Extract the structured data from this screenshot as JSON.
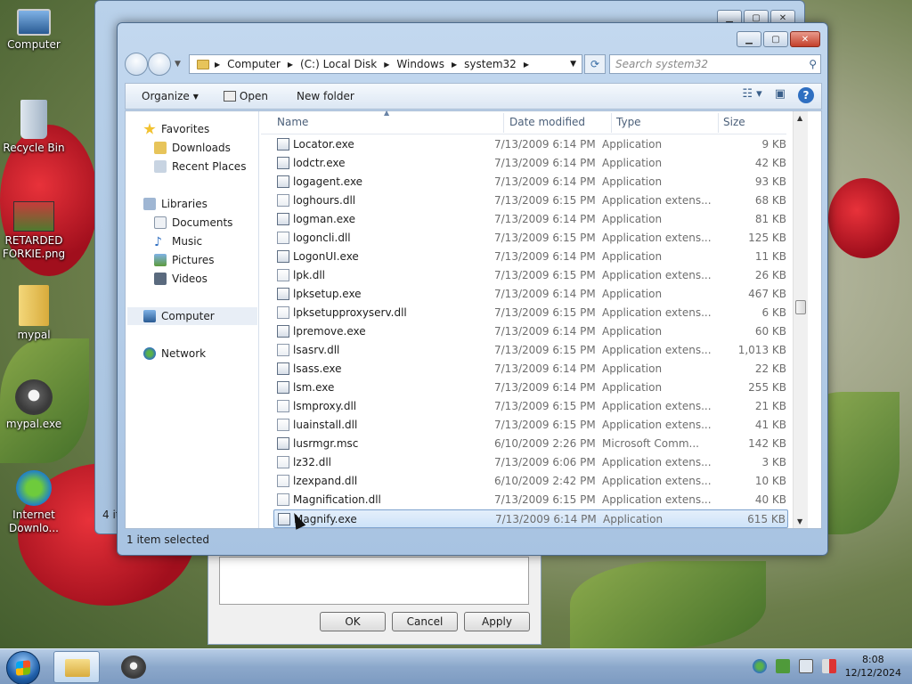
{
  "desktop": {
    "icons": [
      {
        "label": "Computer"
      },
      {
        "label": "Recycle Bin"
      },
      {
        "label": "RETARDED FORKIE.png"
      },
      {
        "label": "mypal"
      },
      {
        "label": "mypal.exe"
      },
      {
        "label": "Internet Downlo..."
      }
    ]
  },
  "back_window": {
    "status_text": "4 it"
  },
  "dialog": {
    "ok": "OK",
    "cancel": "Cancel",
    "apply": "Apply"
  },
  "window": {
    "breadcrumbs": [
      "Computer",
      "(C:) Local Disk",
      "Windows",
      "system32"
    ],
    "search_placeholder": "Search system32",
    "toolbar": {
      "organize": "Organize",
      "open": "Open",
      "new_folder": "New folder"
    },
    "nav": {
      "favorites": "Favorites",
      "downloads": "Downloads",
      "recent_places": "Recent Places",
      "libraries": "Libraries",
      "documents": "Documents",
      "music": "Music",
      "pictures": "Pictures",
      "videos": "Videos",
      "computer": "Computer",
      "network": "Network"
    },
    "columns": {
      "name": "Name",
      "date": "Date modified",
      "type": "Type",
      "size": "Size"
    },
    "files": [
      {
        "name": "Locator.exe",
        "date": "7/13/2009 6:14 PM",
        "type": "Application",
        "size": "9 KB",
        "kind": "exe"
      },
      {
        "name": "lodctr.exe",
        "date": "7/13/2009 6:14 PM",
        "type": "Application",
        "size": "42 KB",
        "kind": "exe"
      },
      {
        "name": "logagent.exe",
        "date": "7/13/2009 6:14 PM",
        "type": "Application",
        "size": "93 KB",
        "kind": "exe"
      },
      {
        "name": "loghours.dll",
        "date": "7/13/2009 6:15 PM",
        "type": "Application extens...",
        "size": "68 KB",
        "kind": "dll"
      },
      {
        "name": "logman.exe",
        "date": "7/13/2009 6:14 PM",
        "type": "Application",
        "size": "81 KB",
        "kind": "exe"
      },
      {
        "name": "logoncli.dll",
        "date": "7/13/2009 6:15 PM",
        "type": "Application extens...",
        "size": "125 KB",
        "kind": "dll"
      },
      {
        "name": "LogonUI.exe",
        "date": "7/13/2009 6:14 PM",
        "type": "Application",
        "size": "11 KB",
        "kind": "exe"
      },
      {
        "name": "lpk.dll",
        "date": "7/13/2009 6:15 PM",
        "type": "Application extens...",
        "size": "26 KB",
        "kind": "dll"
      },
      {
        "name": "lpksetup.exe",
        "date": "7/13/2009 6:14 PM",
        "type": "Application",
        "size": "467 KB",
        "kind": "exe"
      },
      {
        "name": "lpksetupproxyserv.dll",
        "date": "7/13/2009 6:15 PM",
        "type": "Application extens...",
        "size": "6 KB",
        "kind": "dll"
      },
      {
        "name": "lpremove.exe",
        "date": "7/13/2009 6:14 PM",
        "type": "Application",
        "size": "60 KB",
        "kind": "exe"
      },
      {
        "name": "lsasrv.dll",
        "date": "7/13/2009 6:15 PM",
        "type": "Application extens...",
        "size": "1,013 KB",
        "kind": "dll"
      },
      {
        "name": "lsass.exe",
        "date": "7/13/2009 6:14 PM",
        "type": "Application",
        "size": "22 KB",
        "kind": "exe"
      },
      {
        "name": "lsm.exe",
        "date": "7/13/2009 6:14 PM",
        "type": "Application",
        "size": "255 KB",
        "kind": "exe"
      },
      {
        "name": "lsmproxy.dll",
        "date": "7/13/2009 6:15 PM",
        "type": "Application extens...",
        "size": "21 KB",
        "kind": "dll"
      },
      {
        "name": "luainstall.dll",
        "date": "7/13/2009 6:15 PM",
        "type": "Application extens...",
        "size": "41 KB",
        "kind": "dll"
      },
      {
        "name": "lusrmgr.msc",
        "date": "6/10/2009 2:26 PM",
        "type": "Microsoft Comm...",
        "size": "142 KB",
        "kind": "msc"
      },
      {
        "name": "lz32.dll",
        "date": "7/13/2009 6:06 PM",
        "type": "Application extens...",
        "size": "3 KB",
        "kind": "dll"
      },
      {
        "name": "lzexpand.dll",
        "date": "6/10/2009 2:42 PM",
        "type": "Application extens...",
        "size": "10 KB",
        "kind": "dll"
      },
      {
        "name": "Magnification.dll",
        "date": "7/13/2009 6:15 PM",
        "type": "Application extens...",
        "size": "40 KB",
        "kind": "dll"
      },
      {
        "name": "Magnify.exe",
        "date": "7/13/2009 6:14 PM",
        "type": "Application",
        "size": "615 KB",
        "kind": "exe",
        "selected": true
      }
    ],
    "status": "1 item selected"
  },
  "taskbar": {
    "time": "8:08",
    "date": "12/12/2024"
  },
  "colors": {
    "selection": "#cde2f8",
    "taskbar": "#8ca8cb",
    "accent": "#2f6fc1"
  }
}
